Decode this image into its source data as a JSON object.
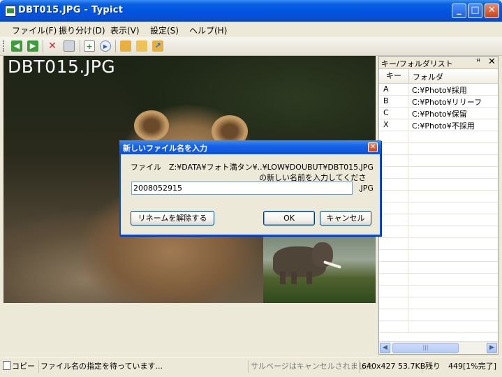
{
  "window": {
    "title": "DBT015.JPG - Typict"
  },
  "menu": [
    "ファイル(F)",
    "振り分け(D)",
    "表示(V)",
    "設定(S)",
    "ヘルプ(H)"
  ],
  "toolbar": {
    "icons": [
      "back-arrow-icon",
      "forward-arrow-icon",
      "delete-icon",
      "rename-icon",
      "new-file-icon",
      "play-icon",
      "folder-icon",
      "open-folder-icon",
      "folder-up-icon"
    ]
  },
  "image": {
    "filename": "DBT015.JPG"
  },
  "key_panel": {
    "title": "キー/フォルダリスト",
    "pin": "ꟸ",
    "close": "✕",
    "col_key": "キー",
    "col_folder": "フォルダ",
    "rows": [
      {
        "key": "A",
        "folder": "C:¥Photo¥採用"
      },
      {
        "key": "B",
        "folder": "C:¥Photo¥リリーフ"
      },
      {
        "key": "C",
        "folder": "C:¥Photo¥保留"
      },
      {
        "key": "X",
        "folder": "C:¥Photo¥不採用"
      }
    ]
  },
  "dialog": {
    "title": "新しいファイル名を入力",
    "message_line1": "ファイル　Z:¥DATA¥フォト満タン¥..¥LOW¥DOUBUT¥DBT015.JPG",
    "message_line2": "の新しい名前を入力してください。",
    "input_value": "2008052915",
    "extension": ".JPG",
    "unrename_button": "リネームを解除する",
    "ok_button": "OK",
    "cancel_button": "キャンセル"
  },
  "status": {
    "mode": "コピー",
    "message": "ファイル名の指定を待っています...",
    "info": "サルベージはキャンセルされました",
    "image_info": "640x427 53.7KB",
    "remaining": "残り　449[1%完了]"
  }
}
